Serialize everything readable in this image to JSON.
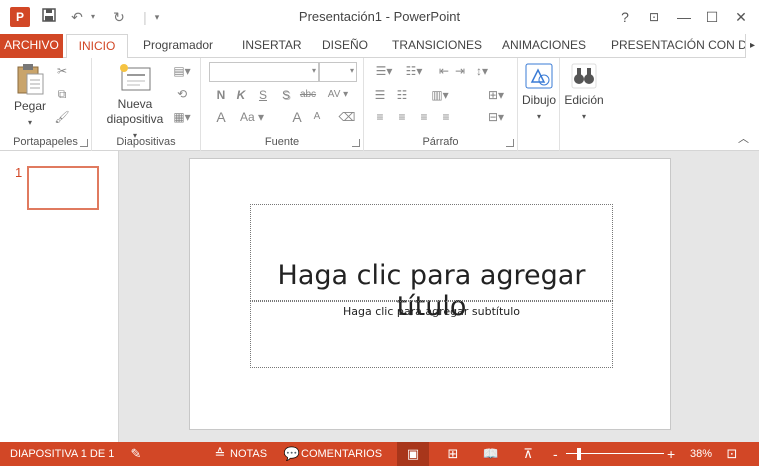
{
  "window": {
    "app_icon": "P",
    "title": "Presentación1 - PowerPoint",
    "help": "?",
    "ribbon_display": "⊡",
    "minimize": "—",
    "maximize": "☐",
    "close": "✕"
  },
  "quick_access": {
    "save_icon": "save-icon",
    "undo_icon": "undo-icon",
    "redo_icon": "redo-icon",
    "customize_icon": "customize-icon"
  },
  "tabs": {
    "file": "ARCHIVO",
    "items": [
      "INICIO",
      "Programador",
      "INSERTAR",
      "DISEÑO",
      "TRANSICIONES",
      "ANIMACIONES",
      "PRESENTACIÓN CON DIA"
    ],
    "scroll": "▸"
  },
  "ribbon": {
    "clipboard": {
      "paste": "Pegar",
      "label": "Portapapeles"
    },
    "slides": {
      "new_slide_line1": "Nueva",
      "new_slide_line2": "diapositiva",
      "label": "Diapositivas"
    },
    "font": {
      "label": "Fuente",
      "bold": "N",
      "italic": "K",
      "underline": "S",
      "shadow": "S",
      "strike": "abc",
      "spacing": "AV",
      "case": "Aa",
      "grow": "A",
      "shrink": "A",
      "color": "A",
      "clear": "⌫"
    },
    "paragraph": {
      "label": "Párrafo"
    },
    "drawing": {
      "label": "Dibujo"
    },
    "editing": {
      "label": "Edición"
    },
    "collapse": "︿"
  },
  "thumbnails": [
    {
      "number": "1"
    }
  ],
  "slide": {
    "title_placeholder": "Haga clic para agregar título",
    "subtitle_placeholder": "Haga clic para agregar subtítulo"
  },
  "statusbar": {
    "slide_counter": "DIAPOSITIVA 1 DE 1",
    "notes": "NOTAS",
    "comments": "COMENTARIOS",
    "zoom_minus": "-",
    "zoom_plus": "+",
    "zoom": "38%"
  },
  "colors": {
    "accent": "#d24726",
    "workarea": "#e6e6e6"
  }
}
